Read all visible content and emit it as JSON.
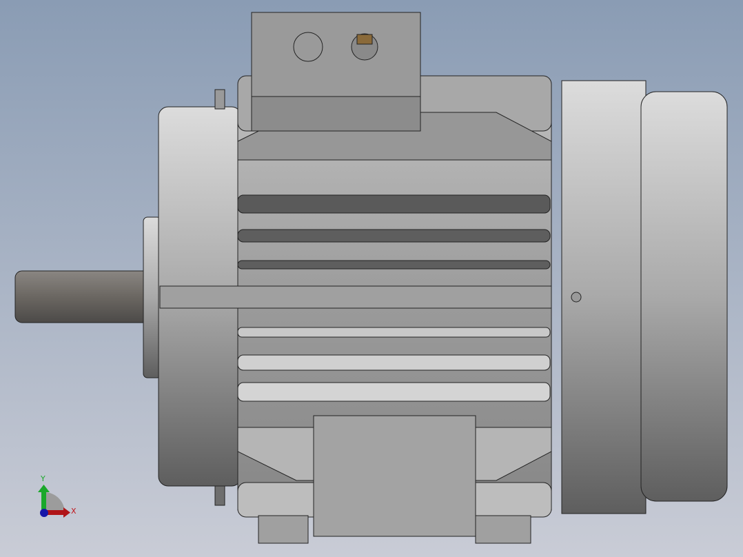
{
  "viewport": {
    "model": "electric-motor",
    "triad": {
      "x_label": "X",
      "y_label": "Y",
      "x_color": "#c0141b",
      "y_color": "#1aa82a",
      "z_color": "#1616a8"
    }
  }
}
